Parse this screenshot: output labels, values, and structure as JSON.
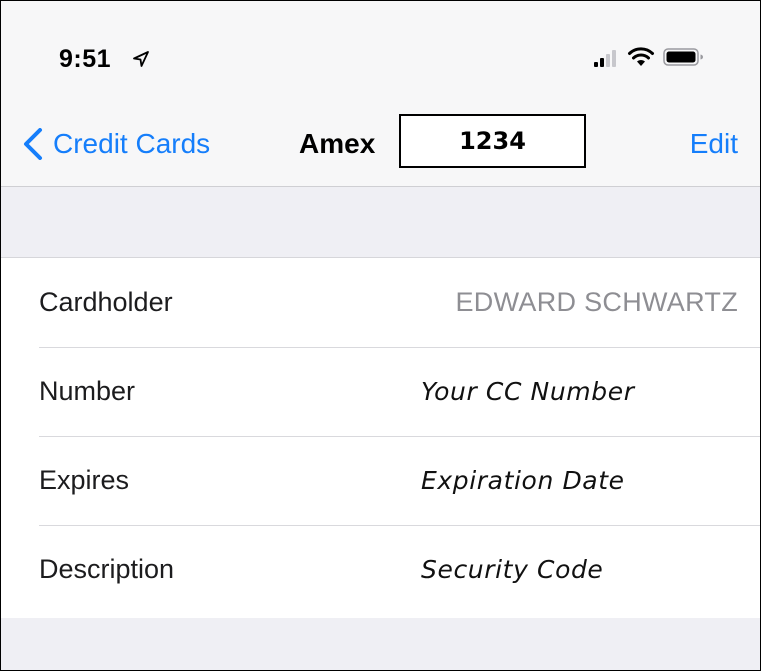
{
  "status_bar": {
    "time": "9:51"
  },
  "nav": {
    "back_label": "Credit Cards",
    "title": "Amex",
    "redaction_text": "1234",
    "edit_label": "Edit"
  },
  "rows": [
    {
      "label": "Cardholder",
      "value": "EDWARD SCHWARTZ"
    },
    {
      "label": "Number",
      "value": "Your CC Number"
    },
    {
      "label": "Expires",
      "value": "Expiration Date"
    },
    {
      "label": "Description",
      "value": "Security Code"
    }
  ],
  "colors": {
    "accent": "#157efb",
    "secondary_text": "#8e8e93",
    "group_background": "#efeff4"
  }
}
